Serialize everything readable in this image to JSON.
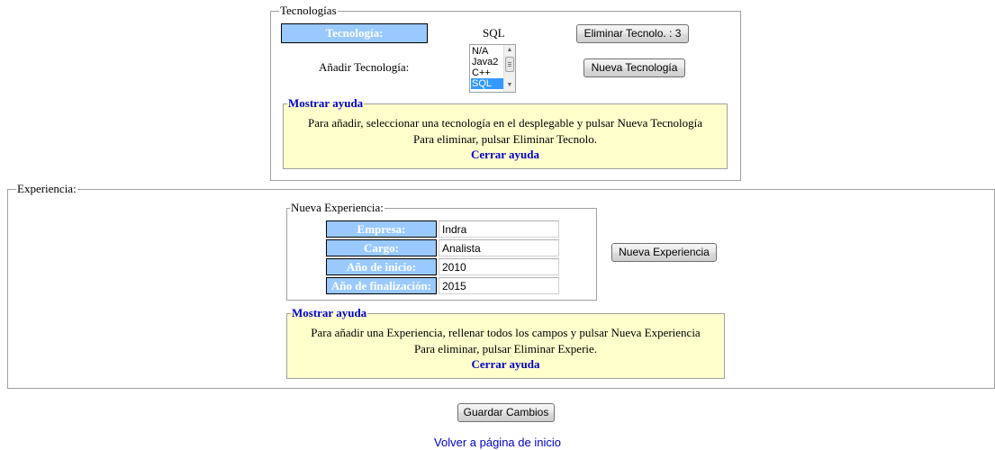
{
  "tecnologias": {
    "legend": "Tecnologías",
    "tecnologia_label": "Tecnología:",
    "tecnologia_value": "SQL",
    "eliminar_button": "Eliminar Tecnolo. : 3",
    "anadir_label": "Añadir Tecnología:",
    "options": [
      {
        "label": "N/A",
        "selected": false
      },
      {
        "label": "Java2",
        "selected": false
      },
      {
        "label": "C++",
        "selected": false
      },
      {
        "label": "SQL",
        "selected": true
      }
    ],
    "nueva_button": "Nueva Tecnología",
    "help": {
      "toggle": "Mostrar ayuda",
      "line1": "Para añadir, seleccionar una tecnología en el desplegable y pulsar Nueva Tecnología",
      "line2": "Para eliminar, pulsar Eliminar Tecnolo.",
      "close": "Cerrar ayuda"
    }
  },
  "experiencia": {
    "legend": "Experiencia:",
    "nueva_legend": "Nueva Experiencia:",
    "fields": [
      {
        "label": "Empresa:",
        "value": "Indra"
      },
      {
        "label": "Cargo:",
        "value": "Analista"
      },
      {
        "label": "Año de inicio:",
        "value": "2010"
      },
      {
        "label": "Año de finalización:",
        "value": "2015"
      }
    ],
    "nueva_button": "Nueva Experiencia",
    "help": {
      "toggle": "Mostrar ayuda",
      "line1": "Para añadir una Experiencia, rellenar todos los campos y pulsar Nueva Experiencia",
      "line2": "Para eliminar, pulsar Eliminar Experie.",
      "close": "Cerrar ayuda"
    }
  },
  "guardar_button": "Guardar Cambios",
  "volver_link": "Volver a página de inicio",
  "colors": {
    "label_bg": "#99c9ff",
    "help_bg": "#ffffcc",
    "link": "#0000cc",
    "selected_option": "#3399ff"
  }
}
